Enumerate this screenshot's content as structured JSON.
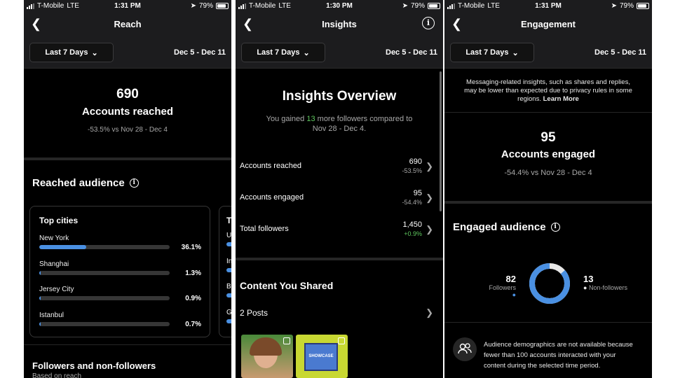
{
  "colors": {
    "accent": "#4a90e2",
    "positive": "#5fc85f",
    "background": "#000000"
  },
  "status": {
    "carrier": "T-Mobile",
    "network": "LTE",
    "battery": "79%",
    "time_reach": "1:31 PM",
    "time_insights": "1:30 PM",
    "time_engagement": "1:31 PM"
  },
  "filter": {
    "range_label": "Last 7 Days",
    "date_range": "Dec 5 - Dec 11"
  },
  "reach": {
    "title": "Reach",
    "count": "690",
    "count_label": "Accounts reached",
    "comparison": "-53.5% vs Nov 28 - Dec 4",
    "audience_title": "Reached audience",
    "top_cities_title": "Top cities",
    "cities": [
      {
        "name": "New York",
        "pct": "36.1%",
        "value": 36.1
      },
      {
        "name": "Shanghai",
        "pct": "1.3%",
        "value": 1.3
      },
      {
        "name": "Jersey City",
        "pct": "0.9%",
        "value": 0.9
      },
      {
        "name": "Istanbul",
        "pct": "0.7%",
        "value": 0.7
      }
    ],
    "next_card_title": "To",
    "next_card_rows": [
      "Un",
      "Inc",
      "Bra",
      "Ge"
    ],
    "followers_title": "Followers and non-followers",
    "followers_sub": "Based on reach"
  },
  "insights": {
    "title": "Insights",
    "overview_title": "Insights Overview",
    "gain_prefix": "You gained ",
    "gain_count": "13",
    "gain_suffix": " more followers compared to",
    "gain_period": "Nov 28 - Dec 4.",
    "rows": [
      {
        "label": "Accounts reached",
        "value": "690",
        "delta": "-53.5%"
      },
      {
        "label": "Accounts engaged",
        "value": "95",
        "delta": "-54.4%"
      },
      {
        "label": "Total followers",
        "value": "1,450",
        "delta": "+0.9%"
      }
    ],
    "content_title": "Content You Shared",
    "posts_label": "2 Posts",
    "thumb2_text": "SHOWCASE"
  },
  "engagement": {
    "title": "Engagement",
    "notice": "Messaging-related insights, such as shares and replies, may be lower than expected due to privacy rules in some regions.",
    "learn_more": "Learn More",
    "count": "95",
    "count_label": "Accounts engaged",
    "comparison": "-54.4% vs Nov 28 - Dec 4",
    "audience_title": "Engaged audience",
    "followers_count": "82",
    "followers_label": "Followers",
    "nonfollowers_count": "13",
    "nonfollowers_label": "Non-followers",
    "followers_fraction": 0.863,
    "demographics_note": "Audience demographics are not available because fewer than 100 accounts interacted with your content during the selected time period."
  }
}
